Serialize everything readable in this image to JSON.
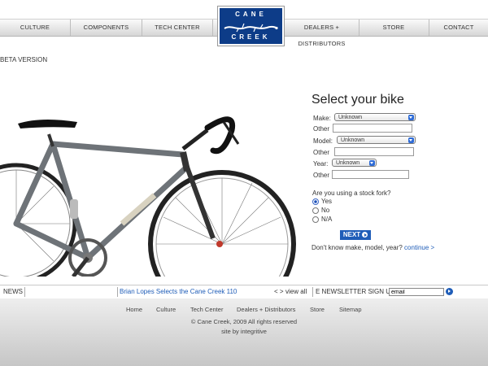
{
  "nav": {
    "items": [
      "CULTURE",
      "COMPONENTS",
      "TECH CENTER",
      "DEALERS + DISTRIBUTORS",
      "STORE",
      "CONTACT"
    ]
  },
  "logo": {
    "line1": "CANE",
    "line2": "CREEK"
  },
  "beta_label": "BETA VERSION",
  "selector": {
    "title": "Select your bike",
    "make_label": "Make:",
    "make_value": "Unknown",
    "other1_label": "Other",
    "model_label": "Model:",
    "model_value": "Unknown",
    "other2_label": "Other",
    "year_label": "Year:",
    "year_value": "Unknown",
    "other3_label": "Other",
    "fork_question": "Are you using a stock fork?",
    "options": [
      "Yes",
      "No",
      "N/A"
    ],
    "selected_option": "Yes",
    "next_label": "NEXT",
    "dont_know_text": "Don't know make, model, year?",
    "continue_link": "continue >"
  },
  "newsbar": {
    "news_label": "NEWS",
    "headline": "Brian Lopes Selects the Cane Creek 110",
    "arrows": "< >",
    "view_all": "view all",
    "newsletter_label": "E NEWSLETTER SIGN UP",
    "email_value": "email"
  },
  "footer": {
    "links": [
      "Home",
      "Culture",
      "Tech Center",
      "Dealers + Distributors",
      "Store",
      "Sitemap"
    ],
    "copyright": "© Cane Creek, 2009 All rights reserved",
    "credit": "site by integritive"
  },
  "colors": {
    "brand_blue": "#0d3c88",
    "link_blue": "#1f5db8"
  }
}
